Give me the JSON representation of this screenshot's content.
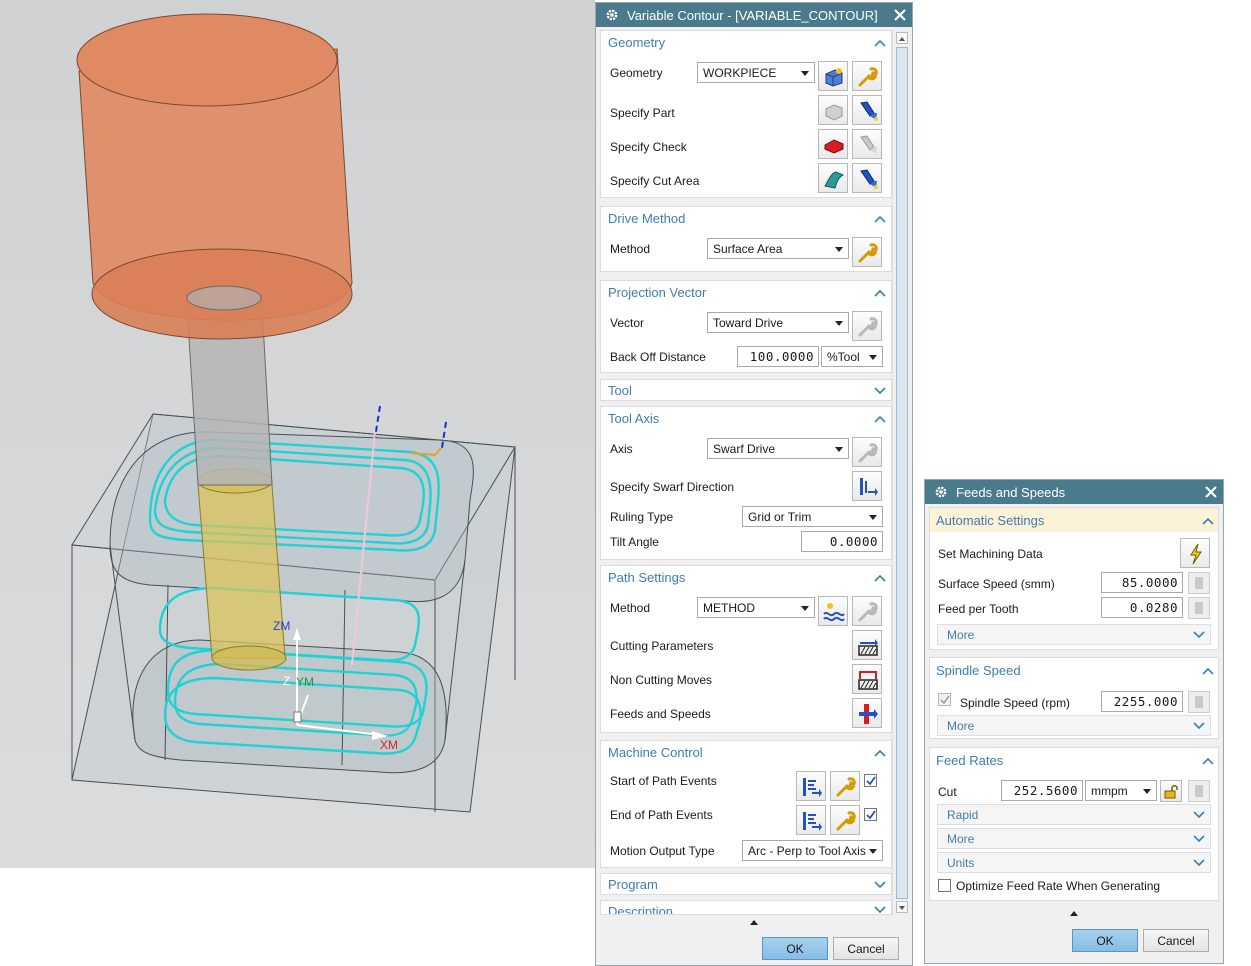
{
  "viewport": {
    "axes": {
      "zm": "ZM",
      "ym": "YM",
      "xm": "XM",
      "z_small": "Z"
    },
    "colors": {
      "holder": "#e08a64",
      "toolpath": "#1fd2d6",
      "shank": "#b5b5b5",
      "flute": "#d9c35a"
    }
  },
  "variable_contour": {
    "title": "Variable Contour - [VARIABLE_CONTOUR]",
    "sections": {
      "geometry": {
        "header": "Geometry",
        "geometry_label": "Geometry",
        "geometry_value": "WORKPIECE",
        "specify_part": "Specify Part",
        "specify_check": "Specify Check",
        "specify_cut_area": "Specify Cut Area"
      },
      "drive_method": {
        "header": "Drive Method",
        "method_label": "Method",
        "method_value": "Surface Area"
      },
      "projection_vector": {
        "header": "Projection Vector",
        "vector_label": "Vector",
        "vector_value": "Toward Drive",
        "back_off_label": "Back Off Distance",
        "back_off_value": "100.0000",
        "back_off_unit": "%Tool"
      },
      "tool": {
        "header": "Tool"
      },
      "tool_axis": {
        "header": "Tool Axis",
        "axis_label": "Axis",
        "axis_value": "Swarf Drive",
        "swarf_dir_label": "Specify Swarf Direction",
        "ruling_label": "Ruling Type",
        "ruling_value": "Grid or Trim",
        "tilt_label": "Tilt Angle",
        "tilt_value": "0.0000"
      },
      "path_settings": {
        "header": "Path Settings",
        "method_label": "Method",
        "method_value": "METHOD",
        "cutting_params": "Cutting Parameters",
        "non_cutting": "Non Cutting Moves",
        "feeds_speeds": "Feeds and Speeds"
      },
      "machine_control": {
        "header": "Machine Control",
        "start_events": "Start of Path Events",
        "end_events": "End of Path Events",
        "motion_output_label": "Motion Output Type",
        "motion_output_value": "Arc - Perp to Tool Axis"
      },
      "program": {
        "header": "Program"
      },
      "description": {
        "header": "Description"
      }
    },
    "ok_label": "OK",
    "cancel_label": "Cancel"
  },
  "feeds_speeds": {
    "title": "Feeds and Speeds",
    "automatic": {
      "header": "Automatic Settings",
      "set_machining_data": "Set Machining Data",
      "surface_speed_label": "Surface Speed (smm)",
      "surface_speed_value": "85.0000",
      "feed_per_tooth_label": "Feed per Tooth",
      "feed_per_tooth_value": "0.0280",
      "more": "More"
    },
    "spindle": {
      "header": "Spindle Speed",
      "spindle_label": "Spindle Speed (rpm)",
      "spindle_value": "2255.000",
      "more": "More"
    },
    "feed_rates": {
      "header": "Feed Rates",
      "cut_label": "Cut",
      "cut_value": "252.5600",
      "cut_unit": "mmpm",
      "rapid": "Rapid",
      "more": "More",
      "units": "Units",
      "optimize_label": "Optimize Feed Rate When Generating"
    },
    "ok_label": "OK",
    "cancel_label": "Cancel"
  }
}
